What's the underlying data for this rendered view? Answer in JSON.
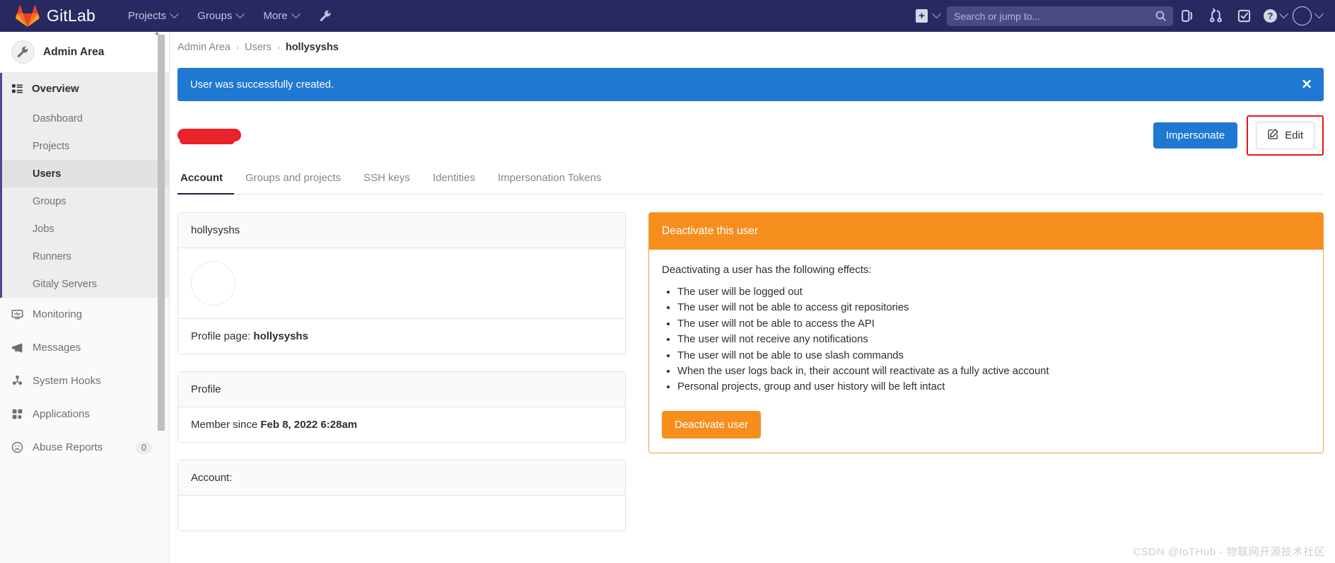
{
  "topnav": {
    "brand": "GitLab",
    "logo_icon": "gitlab-fox-logo",
    "items": [
      {
        "label": "Projects",
        "icon": "chevron-down-icon"
      },
      {
        "label": "Groups",
        "icon": "chevron-down-icon"
      },
      {
        "label": "More",
        "icon": "chevron-down-icon"
      }
    ],
    "wrench_icon": "wrench-icon",
    "plus_label": "+",
    "plus_icon": "plus-square-icon",
    "search_placeholder": "Search or jump to...",
    "search_value": "",
    "search_icon": "magnifier-icon",
    "icons": [
      {
        "name": "issues-icon",
        "title": "Issues"
      },
      {
        "name": "merge-requests-icon",
        "title": "Merge requests"
      },
      {
        "name": "todos-icon",
        "title": "To-Do List"
      }
    ],
    "help_label": "?",
    "help_icon": "question-circle-icon",
    "avatar_icon": "user-avatar"
  },
  "sidebar": {
    "title": "Admin Area",
    "title_icon": "wrench-icon",
    "overview": {
      "label": "Overview",
      "icon": "overview-icon",
      "sub_items": [
        {
          "label": "Dashboard",
          "active": false
        },
        {
          "label": "Projects",
          "active": false
        },
        {
          "label": "Users",
          "active": true
        },
        {
          "label": "Groups",
          "active": false
        },
        {
          "label": "Jobs",
          "active": false
        },
        {
          "label": "Runners",
          "active": false
        },
        {
          "label": "Gitaly Servers",
          "active": false
        }
      ]
    },
    "items": [
      {
        "label": "Monitoring",
        "icon": "monitor-icon",
        "badge": ""
      },
      {
        "label": "Messages",
        "icon": "megaphone-icon",
        "badge": ""
      },
      {
        "label": "System Hooks",
        "icon": "hook-icon",
        "badge": ""
      },
      {
        "label": "Applications",
        "icon": "apps-grid-icon",
        "badge": ""
      },
      {
        "label": "Abuse Reports",
        "icon": "frown-circle-icon",
        "badge": "0"
      }
    ]
  },
  "breadcrumb": {
    "items": [
      "Admin Area",
      "Users"
    ],
    "current": "hollysyshs",
    "separator": "›"
  },
  "alert": {
    "message": "User was successfully created.",
    "close_label": "✕",
    "color": "#1f78d1"
  },
  "page_head": {
    "username_redacted": true,
    "impersonate_label": "Impersonate",
    "edit_label": "Edit",
    "edit_icon": "pencil-square-icon",
    "highlight_color": "#ef1414"
  },
  "tabs": [
    {
      "label": "Account",
      "active": true
    },
    {
      "label": "Groups and projects",
      "active": false
    },
    {
      "label": "SSH keys",
      "active": false
    },
    {
      "label": "Identities",
      "active": false
    },
    {
      "label": "Impersonation Tokens",
      "active": false
    }
  ],
  "user_card": {
    "header": "hollysyshs",
    "avatar_icon": "user-avatar-large",
    "profile_page_label": "Profile page:",
    "profile_page_value": "hollysyshs"
  },
  "profile_card": {
    "header": "Profile",
    "member_since_label": "Member since",
    "member_since_value": "Feb 8, 2022 6:28am"
  },
  "account_card": {
    "header": "Account:"
  },
  "deactivate": {
    "header": "Deactivate this user",
    "intro": "Deactivating a user has the following effects:",
    "effects": [
      "The user will be logged out",
      "The user will not be able to access git repositories",
      "The user will not be able to access the API",
      "The user will not receive any notifications",
      "The user will not be able to use slash commands",
      "When the user logs back in, their account will reactivate as a fully active account",
      "Personal projects, group and user history will be left intact"
    ],
    "button_label": "Deactivate user",
    "accent_color": "#f68e1e"
  },
  "watermark": "CSDN @IoTHub - 物联网开源技术社区"
}
